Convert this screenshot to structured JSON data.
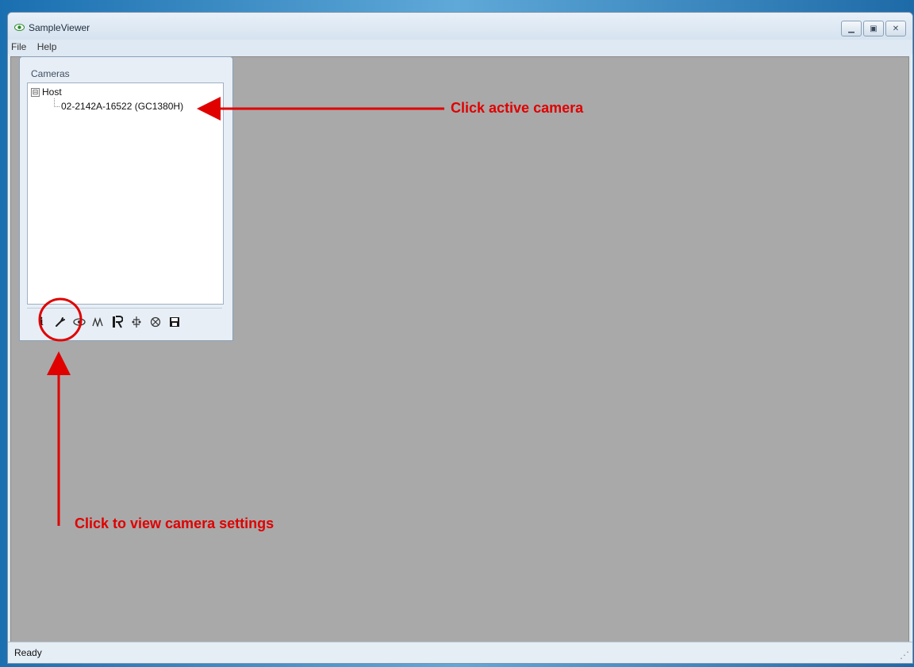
{
  "window": {
    "title": "SampleViewer",
    "controls": {
      "minimize_icon": "minimize-icon",
      "maximize_icon": "maximize-icon",
      "close_icon": "close-icon"
    }
  },
  "menu": {
    "items": [
      {
        "label": "File"
      },
      {
        "label": "Help"
      }
    ]
  },
  "cameras_panel": {
    "title": "Cameras",
    "tree": {
      "host_label": "Host",
      "host_expander": "⊟",
      "camera_label": "02-2142A-16522 (GC1380H)"
    },
    "toolbar": {
      "icons": [
        {
          "name": "info-icon",
          "glyph": "i"
        },
        {
          "name": "wrench-icon",
          "glyph": "🔧"
        },
        {
          "name": "eye-icon",
          "glyph": "👁"
        },
        {
          "name": "waveform-icon",
          "glyph": "ʍ"
        },
        {
          "name": "register-icon",
          "glyph": "Ⓡ"
        },
        {
          "name": "ip-config-icon",
          "glyph": "⋔"
        },
        {
          "name": "force-ip-icon",
          "glyph": "⊗"
        },
        {
          "name": "save-icon",
          "glyph": "💾"
        }
      ]
    }
  },
  "status_bar": {
    "text": "Ready"
  },
  "annotations": {
    "active_camera_text": "Click active camera",
    "settings_text": "Click to view camera settings",
    "color": "#e00000"
  }
}
